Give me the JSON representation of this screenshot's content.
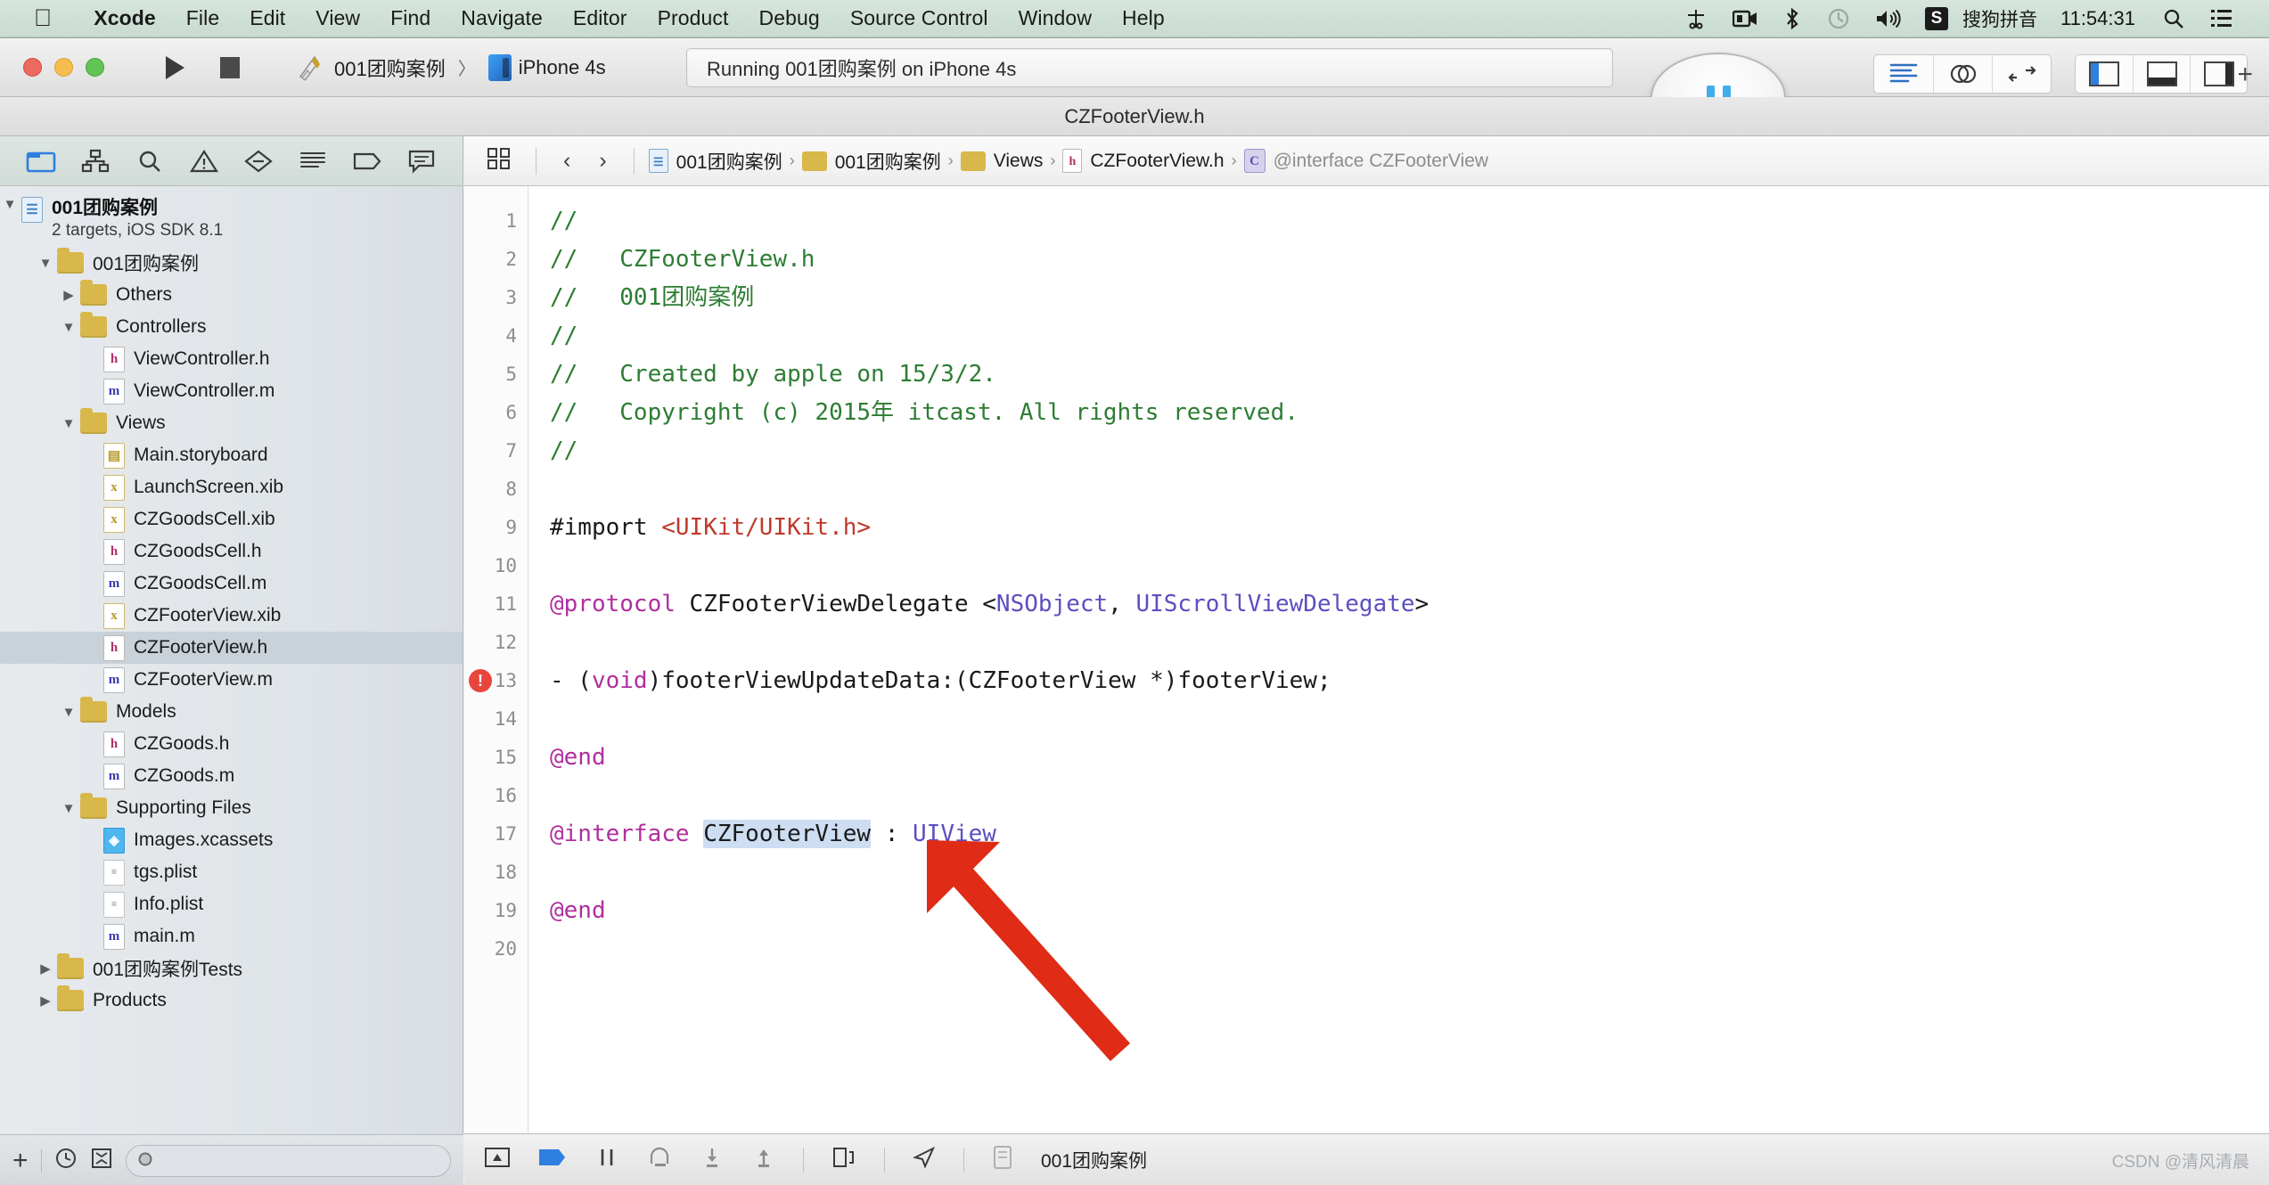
{
  "menubar": {
    "apple_glyph": "",
    "items": [
      {
        "label": "Xcode",
        "bold": true
      },
      {
        "label": "File",
        "bold": false
      },
      {
        "label": "Edit",
        "bold": false
      },
      {
        "label": "View",
        "bold": false
      },
      {
        "label": "Find",
        "bold": false
      },
      {
        "label": "Navigate",
        "bold": false
      },
      {
        "label": "Editor",
        "bold": false
      },
      {
        "label": "Product",
        "bold": false
      },
      {
        "label": "Debug",
        "bold": false
      },
      {
        "label": "Source Control",
        "bold": false
      },
      {
        "label": "Window",
        "bold": false
      },
      {
        "label": "Help",
        "bold": false
      }
    ],
    "status": {
      "ime_badge": "S",
      "ime_label": "搜狗拼音",
      "clock": "11:54:31",
      "icons": [
        "scissors-icon",
        "screen-record-icon",
        "bluetooth-icon",
        "time-machine-icon",
        "volume-icon",
        "spotlight-search-icon",
        "notification-center-icon"
      ]
    }
  },
  "toolbar": {
    "run_label": "Run",
    "stop_label": "Stop",
    "scheme_name": "001团购案例",
    "scheme_separator": "〉",
    "destination_name": "iPhone 4s",
    "status_text": "Running 001团购案例 on iPhone 4s",
    "pause_label": "Pause",
    "editor_modes": [
      "standard-editor",
      "assistant-editor",
      "version-editor"
    ],
    "view_toggles": [
      "navigator-pane",
      "debug-pane",
      "utilities-pane"
    ],
    "add_label": "+"
  },
  "titlebar": {
    "title": "CZFooterView.h"
  },
  "navigator": {
    "tabs": [
      "project-navigator",
      "symbol-navigator",
      "find-navigator",
      "issue-navigator",
      "test-navigator",
      "report-navigator",
      "debug-navigator",
      "breakpoint-navigator"
    ],
    "selected_tab": "project-navigator",
    "project": {
      "name": "001团购案例",
      "subtitle": "2 targets, iOS SDK 8.1"
    },
    "tree": [
      {
        "label": "001团购案例",
        "indent": 1,
        "icon": "folder",
        "twisty": "down",
        "selected": false
      },
      {
        "label": "Others",
        "indent": 2,
        "icon": "folder",
        "twisty": "right",
        "selected": false
      },
      {
        "label": "Controllers",
        "indent": 2,
        "icon": "folder",
        "twisty": "down",
        "selected": false
      },
      {
        "label": "ViewController.h",
        "indent": 3,
        "icon": "h",
        "twisty": "",
        "selected": false
      },
      {
        "label": "ViewController.m",
        "indent": 3,
        "icon": "m",
        "twisty": "",
        "selected": false
      },
      {
        "label": "Views",
        "indent": 2,
        "icon": "folder",
        "twisty": "down",
        "selected": false
      },
      {
        "label": "Main.storyboard",
        "indent": 3,
        "icon": "sb",
        "twisty": "",
        "selected": false
      },
      {
        "label": "LaunchScreen.xib",
        "indent": 3,
        "icon": "xib",
        "twisty": "",
        "selected": false
      },
      {
        "label": "CZGoodsCell.xib",
        "indent": 3,
        "icon": "xib",
        "twisty": "",
        "selected": false
      },
      {
        "label": "CZGoodsCell.h",
        "indent": 3,
        "icon": "h",
        "twisty": "",
        "selected": false
      },
      {
        "label": "CZGoodsCell.m",
        "indent": 3,
        "icon": "m",
        "twisty": "",
        "selected": false
      },
      {
        "label": "CZFooterView.xib",
        "indent": 3,
        "icon": "xib",
        "twisty": "",
        "selected": false
      },
      {
        "label": "CZFooterView.h",
        "indent": 3,
        "icon": "h",
        "twisty": "",
        "selected": true
      },
      {
        "label": "CZFooterView.m",
        "indent": 3,
        "icon": "m",
        "twisty": "",
        "selected": false
      },
      {
        "label": "Models",
        "indent": 2,
        "icon": "folder",
        "twisty": "down",
        "selected": false
      },
      {
        "label": "CZGoods.h",
        "indent": 3,
        "icon": "h",
        "twisty": "",
        "selected": false
      },
      {
        "label": "CZGoods.m",
        "indent": 3,
        "icon": "m",
        "twisty": "",
        "selected": false
      },
      {
        "label": "Supporting Files",
        "indent": 2,
        "icon": "folder",
        "twisty": "down",
        "selected": false
      },
      {
        "label": "Images.xcassets",
        "indent": 3,
        "icon": "xcassets",
        "twisty": "",
        "selected": false
      },
      {
        "label": "tgs.plist",
        "indent": 3,
        "icon": "plist",
        "twisty": "",
        "selected": false
      },
      {
        "label": "Info.plist",
        "indent": 3,
        "icon": "plist",
        "twisty": "",
        "selected": false
      },
      {
        "label": "main.m",
        "indent": 3,
        "icon": "m",
        "twisty": "",
        "selected": false
      },
      {
        "label": "001团购案例Tests",
        "indent": 1,
        "icon": "folder",
        "twisty": "right",
        "selected": false
      },
      {
        "label": "Products",
        "indent": 1,
        "icon": "folder",
        "twisty": "right",
        "selected": false
      }
    ],
    "filter": {
      "add_label": "+",
      "placeholder": "",
      "value": "",
      "icons": [
        "add-icon",
        "recent-files-icon",
        "source-control-filter-icon",
        "filter-search-icon"
      ]
    }
  },
  "jumpbar": {
    "related_items_label": "related-items",
    "back_label": "‹",
    "forward_label": "›",
    "crumbs": [
      {
        "label": "001团购案例",
        "icon": "project-icon"
      },
      {
        "label": "001团购案例",
        "icon": "folder-icon"
      },
      {
        "label": "Views",
        "icon": "folder-icon"
      },
      {
        "label": "CZFooterView.h",
        "icon": "h-file-icon"
      },
      {
        "label": "@interface CZFooterView",
        "icon": "interface-icon"
      }
    ]
  },
  "code": {
    "issue_marker_line": 13,
    "issue_marker_glyph": "!",
    "selected_token": "CZFooterView",
    "lines": [
      {
        "n": 1,
        "tokens": [
          {
            "t": "//",
            "c": "cm"
          }
        ]
      },
      {
        "n": 2,
        "tokens": [
          {
            "t": "//   CZFooterView.h",
            "c": "cm"
          }
        ]
      },
      {
        "n": 3,
        "tokens": [
          {
            "t": "//   001团购案例",
            "c": "cm"
          }
        ]
      },
      {
        "n": 4,
        "tokens": [
          {
            "t": "//",
            "c": "cm"
          }
        ]
      },
      {
        "n": 5,
        "tokens": [
          {
            "t": "//   Created by apple on 15/3/2.",
            "c": "cm"
          }
        ]
      },
      {
        "n": 6,
        "tokens": [
          {
            "t": "//   Copyright (c) 2015年 itcast. All rights reserved.",
            "c": "cm"
          }
        ]
      },
      {
        "n": 7,
        "tokens": [
          {
            "t": "//",
            "c": "cm"
          }
        ]
      },
      {
        "n": 8,
        "tokens": []
      },
      {
        "n": 9,
        "tokens": [
          {
            "t": "#import ",
            "c": "pln"
          },
          {
            "t": "<UIKit/UIKit.h>",
            "c": "str"
          }
        ]
      },
      {
        "n": 10,
        "tokens": []
      },
      {
        "n": 11,
        "tokens": [
          {
            "t": "@protocol",
            "c": "kw"
          },
          {
            "t": " CZFooterViewDelegate <",
            "c": "pln"
          },
          {
            "t": "NSObject",
            "c": "typ"
          },
          {
            "t": ", ",
            "c": "pln"
          },
          {
            "t": "UIScrollViewDelegate",
            "c": "typ"
          },
          {
            "t": ">",
            "c": "pln"
          }
        ]
      },
      {
        "n": 12,
        "tokens": []
      },
      {
        "n": 13,
        "tokens": [
          {
            "t": "- (",
            "c": "pln"
          },
          {
            "t": "void",
            "c": "kw"
          },
          {
            "t": ")footerViewUpdateData:(CZFooterView *)footerView;",
            "c": "pln"
          }
        ]
      },
      {
        "n": 14,
        "tokens": []
      },
      {
        "n": 15,
        "tokens": [
          {
            "t": "@end",
            "c": "kw"
          }
        ]
      },
      {
        "n": 16,
        "tokens": []
      },
      {
        "n": 17,
        "tokens": [
          {
            "t": "@interface",
            "c": "kw"
          },
          {
            "t": " ",
            "c": "pln"
          },
          {
            "t": "CZFooterView",
            "c": "pln hl"
          },
          {
            "t": " : ",
            "c": "pln"
          },
          {
            "t": "UIView",
            "c": "typ"
          }
        ]
      },
      {
        "n": 18,
        "tokens": []
      },
      {
        "n": 19,
        "tokens": [
          {
            "t": "@end",
            "c": "kw"
          }
        ]
      },
      {
        "n": 20,
        "tokens": []
      }
    ]
  },
  "debugbar": {
    "scheme_label": "001团购案例",
    "icons": [
      "hide-debug-area-icon",
      "breakpoints-icon",
      "continue-pause-icon",
      "step-over-icon",
      "step-into-icon",
      "step-out-icon",
      "view-hierarchy-icon",
      "location-simulate-icon",
      "process-icon"
    ]
  },
  "annotation": {
    "arrow_color": "#e02b16",
    "arrow_target": "CZFooterView"
  },
  "watermark": {
    "text": "CSDN @清风清晨"
  },
  "colors": {
    "menubar_tint": "#cfe0d6",
    "comment_green": "#2d7d33",
    "keyword_magenta": "#b02f9e",
    "string_red": "#c0392b",
    "type_purple": "#5c4fc0",
    "selection_blue": "#cdddf2",
    "error_red": "#e8453c",
    "accent_blue": "#2f7fe0"
  }
}
